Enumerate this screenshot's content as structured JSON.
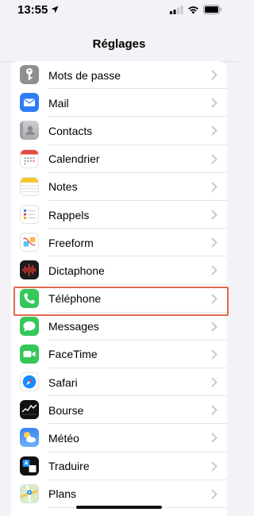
{
  "status_bar": {
    "time": "13:55"
  },
  "nav": {
    "title": "Réglages"
  },
  "rows": [
    {
      "label": "Mots de passe",
      "icon": "key-icon",
      "color": "#8e8e93"
    },
    {
      "label": "Mail",
      "icon": "mail-icon",
      "color": "#2f7cf6"
    },
    {
      "label": "Contacts",
      "icon": "contacts-icon",
      "color": "#b9b9be"
    },
    {
      "label": "Calendrier",
      "icon": "calendar-icon",
      "color": "#ffffff"
    },
    {
      "label": "Notes",
      "icon": "notes-icon",
      "color": "#ffffff"
    },
    {
      "label": "Rappels",
      "icon": "reminders-icon",
      "color": "#ffffff"
    },
    {
      "label": "Freeform",
      "icon": "freeform-icon",
      "color": "#ffffff"
    },
    {
      "label": "Dictaphone",
      "icon": "voice-memos-icon",
      "color": "#1c1c1e"
    },
    {
      "label": "Téléphone",
      "icon": "phone-icon",
      "color": "#34c759"
    },
    {
      "label": "Messages",
      "icon": "messages-icon",
      "color": "#34c759"
    },
    {
      "label": "FaceTime",
      "icon": "facetime-icon",
      "color": "#34c759"
    },
    {
      "label": "Safari",
      "icon": "safari-icon",
      "color": "#1a8cff"
    },
    {
      "label": "Bourse",
      "icon": "stocks-icon",
      "color": "#111111"
    },
    {
      "label": "Météo",
      "icon": "weather-icon",
      "color": "#3d8ee8"
    },
    {
      "label": "Traduire",
      "icon": "translate-icon",
      "color": "#111111"
    },
    {
      "label": "Plans",
      "icon": "maps-icon",
      "color": "#e8f3e0"
    }
  ],
  "highlighted_row": "Téléphone"
}
